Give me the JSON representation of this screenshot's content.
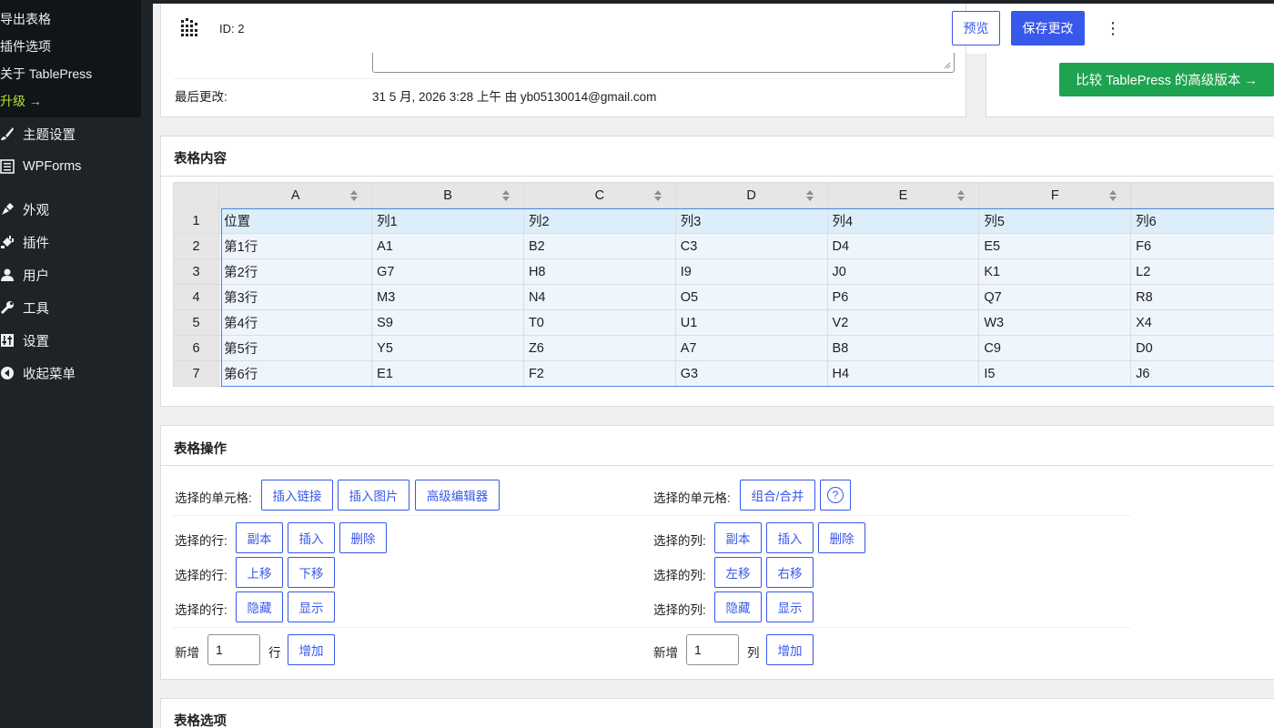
{
  "sidebar": {
    "submenu": [
      {
        "label": "导出表格"
      },
      {
        "label": "插件选项"
      },
      {
        "label": "关于 TablePress"
      },
      {
        "label": "升级 →"
      }
    ],
    "items": [
      {
        "label": "主题设置",
        "icon": "paintbrush-icon"
      },
      {
        "label": "WPForms",
        "icon": "forms-icon"
      },
      {
        "label": "外观",
        "icon": "appearance-icon"
      },
      {
        "label": "插件",
        "icon": "plugins-icon"
      },
      {
        "label": "用户",
        "icon": "users-icon"
      },
      {
        "label": "工具",
        "icon": "tools-icon"
      },
      {
        "label": "设置",
        "icon": "settings-icon"
      },
      {
        "label": "收起菜单",
        "icon": "collapse-icon"
      }
    ]
  },
  "header": {
    "table_id": "ID: 2",
    "preview_label": "预览",
    "save_label": "保存更改",
    "more_label": "⋮"
  },
  "info": {
    "last_modified_label": "最后更改:",
    "last_modified_value": "31 5 月, 2026 3:28 上午 由 yb05130014@gmail.com"
  },
  "upgrade": {
    "label": "比较 TablePress 的高级版本 →"
  },
  "content": {
    "title": "表格内容",
    "columns": [
      "A",
      "B",
      "C",
      "D",
      "E",
      "F",
      ""
    ],
    "rows": [
      {
        "num": "1",
        "cells": [
          "位置",
          "列1",
          "列2",
          "列3",
          "列4",
          "列5",
          "列6"
        ]
      },
      {
        "num": "2",
        "cells": [
          "第1行",
          "A1",
          "B2",
          "C3",
          "D4",
          "E5",
          "F6"
        ]
      },
      {
        "num": "3",
        "cells": [
          "第2行",
          "G7",
          "H8",
          "I9",
          "J0",
          "K1",
          "L2"
        ]
      },
      {
        "num": "4",
        "cells": [
          "第3行",
          "M3",
          "N4",
          "O5",
          "P6",
          "Q7",
          "R8"
        ]
      },
      {
        "num": "5",
        "cells": [
          "第4行",
          "S9",
          "T0",
          "U1",
          "V2",
          "W3",
          "X4"
        ]
      },
      {
        "num": "6",
        "cells": [
          "第5行",
          "Y5",
          "Z6",
          "A7",
          "B8",
          "C9",
          "D0"
        ]
      },
      {
        "num": "7",
        "cells": [
          "第6行",
          "E1",
          "F2",
          "G3",
          "H4",
          "I5",
          "J6"
        ]
      }
    ]
  },
  "operations": {
    "title": "表格操作",
    "cells_label": "选择的单元格:",
    "insert_link": "插入链接",
    "insert_image": "插入图片",
    "advanced_editor": "高级编辑器",
    "cells_label_right": "选择的单元格:",
    "combine": "组合/合并",
    "help": "?",
    "rows_label": "选择的行:",
    "cols_label": "选择的列:",
    "duplicate": "副本",
    "insert": "插入",
    "delete": "删除",
    "move_up": "上移",
    "move_down": "下移",
    "move_left": "左移",
    "move_right": "右移",
    "hide": "隐藏",
    "show": "显示",
    "add_prefix": "新增",
    "row_count": "1",
    "row_suffix": "行",
    "col_count": "1",
    "col_suffix": "列",
    "add_button": "增加"
  },
  "options": {
    "title": "表格选项"
  },
  "colors": {
    "accent": "#3858e9",
    "sidebar": "#1d2327",
    "upgrade_green": "#1ea350",
    "upgrade_text": "#b8e036"
  }
}
